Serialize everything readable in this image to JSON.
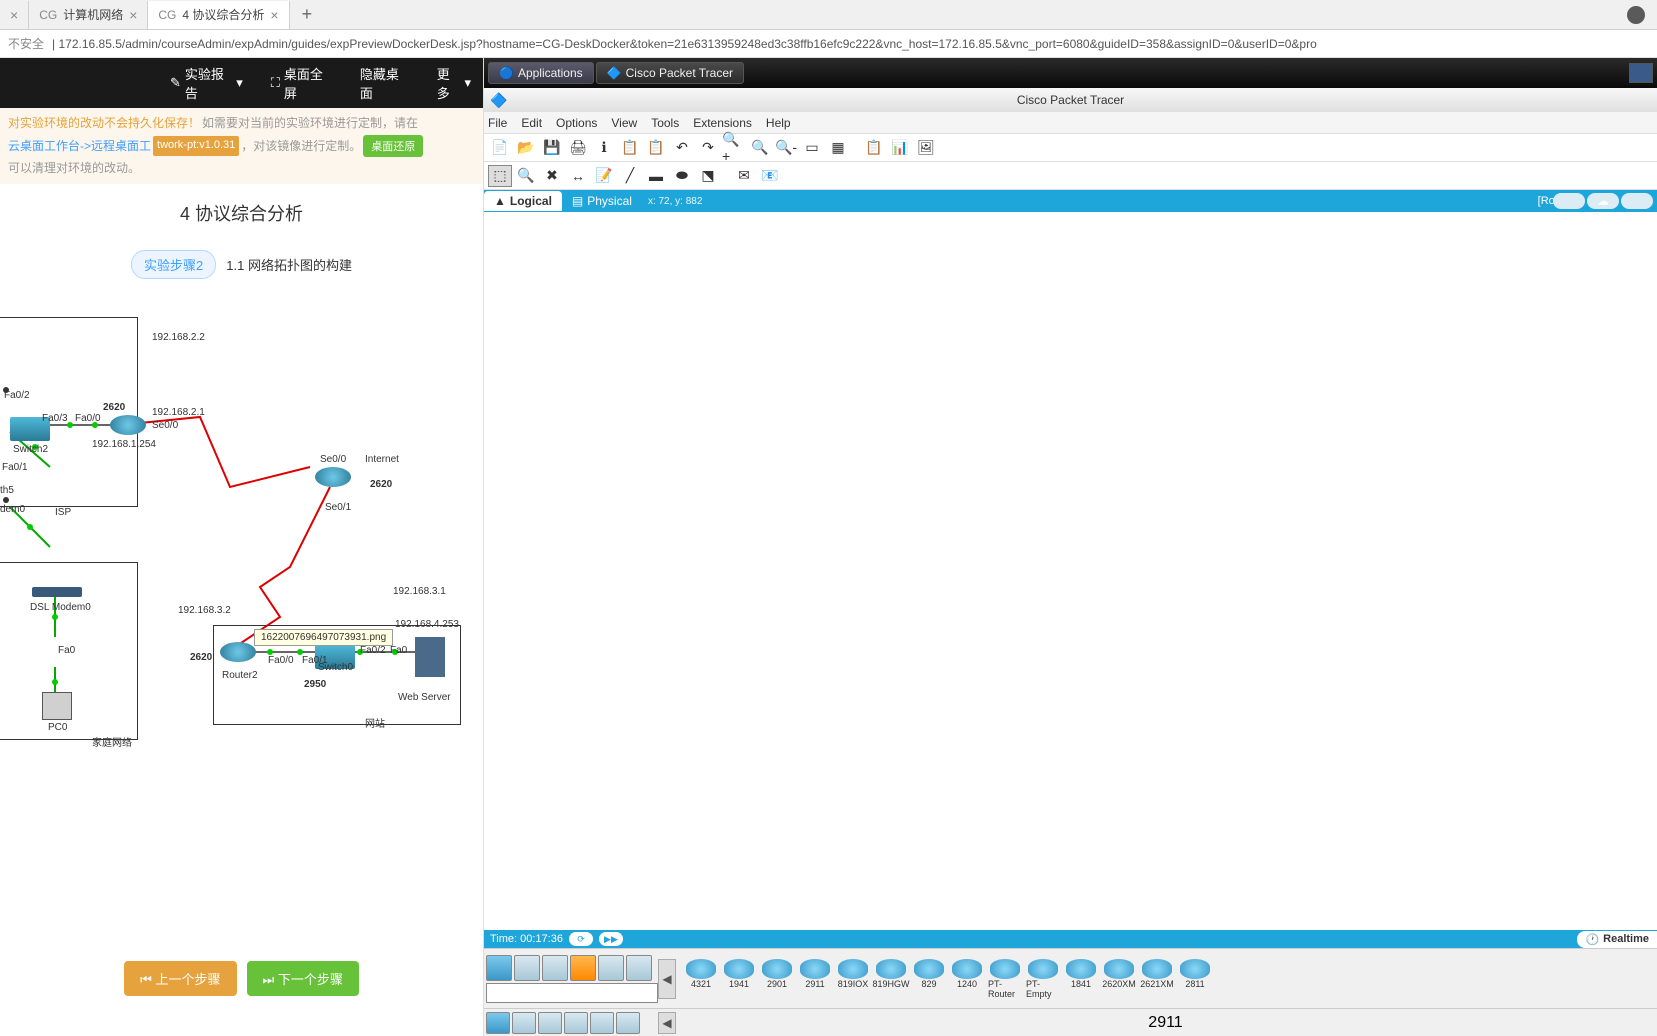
{
  "browser": {
    "tabs": [
      {
        "label": "",
        "close": "×"
      },
      {
        "label": "计算机网络",
        "prefix": "CG",
        "close": "×"
      },
      {
        "label": "4 协议综合分析",
        "prefix": "CG",
        "close": "×",
        "active": true
      }
    ],
    "address": {
      "insecure": "不安全",
      "url": "172.16.85.5/admin/courseAdmin/expAdmin/guides/expPreviewDockerDesk.jsp?hostname=CG-DeskDocker&token=21e6313959248ed3c38ffb16efc9c222&vnc_host=172.16.85.5&vnc_port=6080&guideID=358&assignID=0&userID=0&pro"
    }
  },
  "left": {
    "toolbar": {
      "report": "实验报告",
      "fullscreen": "桌面全屏",
      "hide": "隐藏桌面",
      "more": "更多"
    },
    "warning": {
      "t1": "对实验环境的改动不会持久化保存！",
      "t2": "如需要对当前的实验环境进行定制，请在",
      "link": "云桌面工作台->远程桌面工",
      "code": "twork-pt:v1.0.31",
      "t3": "，对该镜像进行定制。",
      "reset_btn": "桌面还原",
      "t4": "可以清理对环境的改动。"
    },
    "title": "4 协议综合分析",
    "step": {
      "pill": "实验步骤2",
      "text": "1.1 网络拓扑图的构建"
    },
    "topology": {
      "tooltip": "1622007696497073931.png",
      "labels": {
        "fa02": "Fa0/2",
        "fa03": "Fa0/3",
        "fa00": "Fa0/0",
        "fa01": "Fa0/1",
        "switch2": "Switch2",
        "r2620a": "2620",
        "ip1254": "192.168.1.254",
        "ip22": "192.168.2.2",
        "ip21": "192.168.2.1",
        "se00": "Se0/0",
        "se00_2": "Se0/0",
        "internet": "Internet",
        "r2620b": "2620",
        "se01": "Se0/1",
        "th5": "th5",
        "dem0": "dem0",
        "isp": "ISP",
        "dslmodem": "DSL Modem0",
        "fa0a": "Fa0",
        "pc0": "PC0",
        "home": "家庭网络",
        "ip32": "192.168.3.2",
        "r2620c": "2620",
        "router2": "Router2",
        "fa00b": "Fa0/0",
        "fa01b": "Fa0/1",
        "fa02b": "Fa0/2",
        "fa0b": "Fa0",
        "switch0": "Switch0",
        "s2950": "2950",
        "ip4253": "192.168.4.253",
        "webserver": "Web Server",
        "site": "网站",
        "ip31": "192.168.3.1"
      }
    },
    "nav": {
      "prev": "上一个步骤",
      "next": "下一个步骤"
    }
  },
  "vnc": {
    "taskbar": {
      "applications": "Applications",
      "packet_tracer": "Cisco Packet Tracer"
    },
    "pt": {
      "title": "Cisco Packet Tracer",
      "menu": [
        "File",
        "Edit",
        "Options",
        "View",
        "Tools",
        "Extensions",
        "Help"
      ],
      "views": {
        "logical": "Logical",
        "physical": "Physical",
        "coord": "x: 72, y: 882",
        "root": "[Root]"
      },
      "time": {
        "label": "Time: 00:17:36",
        "realtime": "Realtime"
      },
      "devices": [
        "4321",
        "1941",
        "2901",
        "2911",
        "819IOX",
        "819HGW",
        "829",
        "1240",
        "PT-Router",
        "PT-Empty",
        "1841",
        "2620XM",
        "2621XM",
        "2811"
      ],
      "selected_device": "2911"
    }
  }
}
